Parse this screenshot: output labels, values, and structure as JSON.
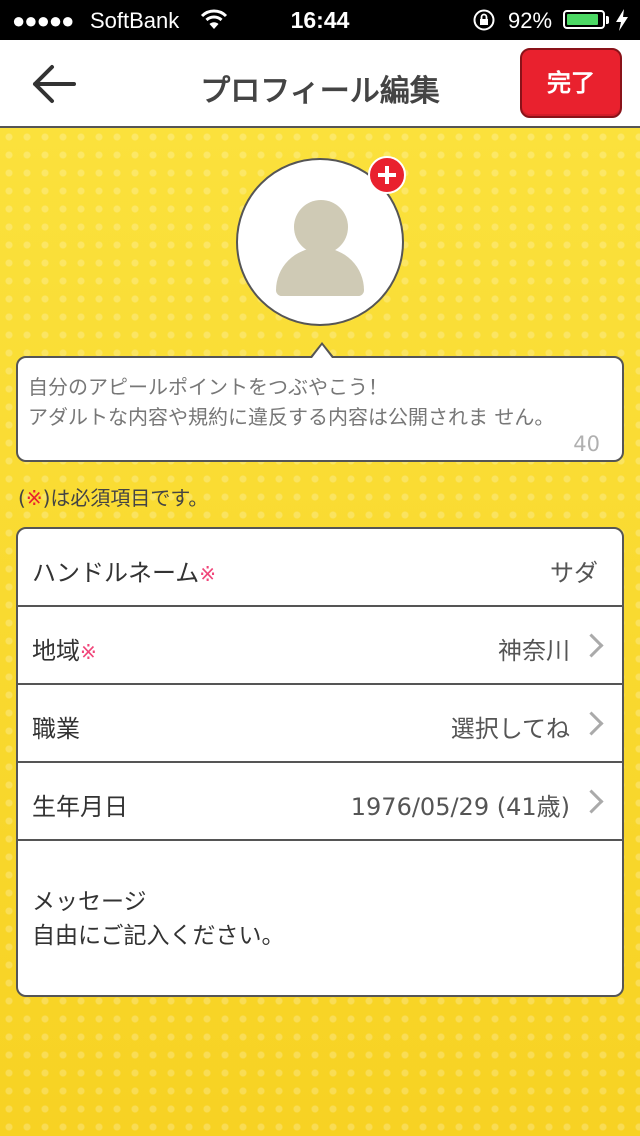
{
  "status_bar": {
    "signal": "●●●●●",
    "carrier": "SoftBank",
    "time": "16:44",
    "battery_percent": "92%",
    "battery_level": 0.92,
    "battery_color": "#4cd964"
  },
  "header": {
    "title": "プロフィール編集",
    "done_label": "完了",
    "accent_color": "#e9212e"
  },
  "appeal": {
    "placeholder": "自分のアピールポイントをつぶやこう！\nアダルトな内容や規約に違反する内容は公開されま せん。",
    "counter": "40"
  },
  "required_note": {
    "open": "(",
    "mark": "※",
    "text": ")は必須項目です。"
  },
  "form": {
    "rows": [
      {
        "label": "ハンドルネーム",
        "required_mark": "※",
        "value": "サダ"
      },
      {
        "label": "地域",
        "required_mark": "※",
        "value": "神奈川"
      },
      {
        "label": "職業",
        "value": "選択してね"
      },
      {
        "label": "生年月日",
        "value": "1976/05/29 (41歳)"
      }
    ],
    "message": {
      "label": "メッセージ",
      "placeholder": "自由にご記入ください。"
    }
  }
}
